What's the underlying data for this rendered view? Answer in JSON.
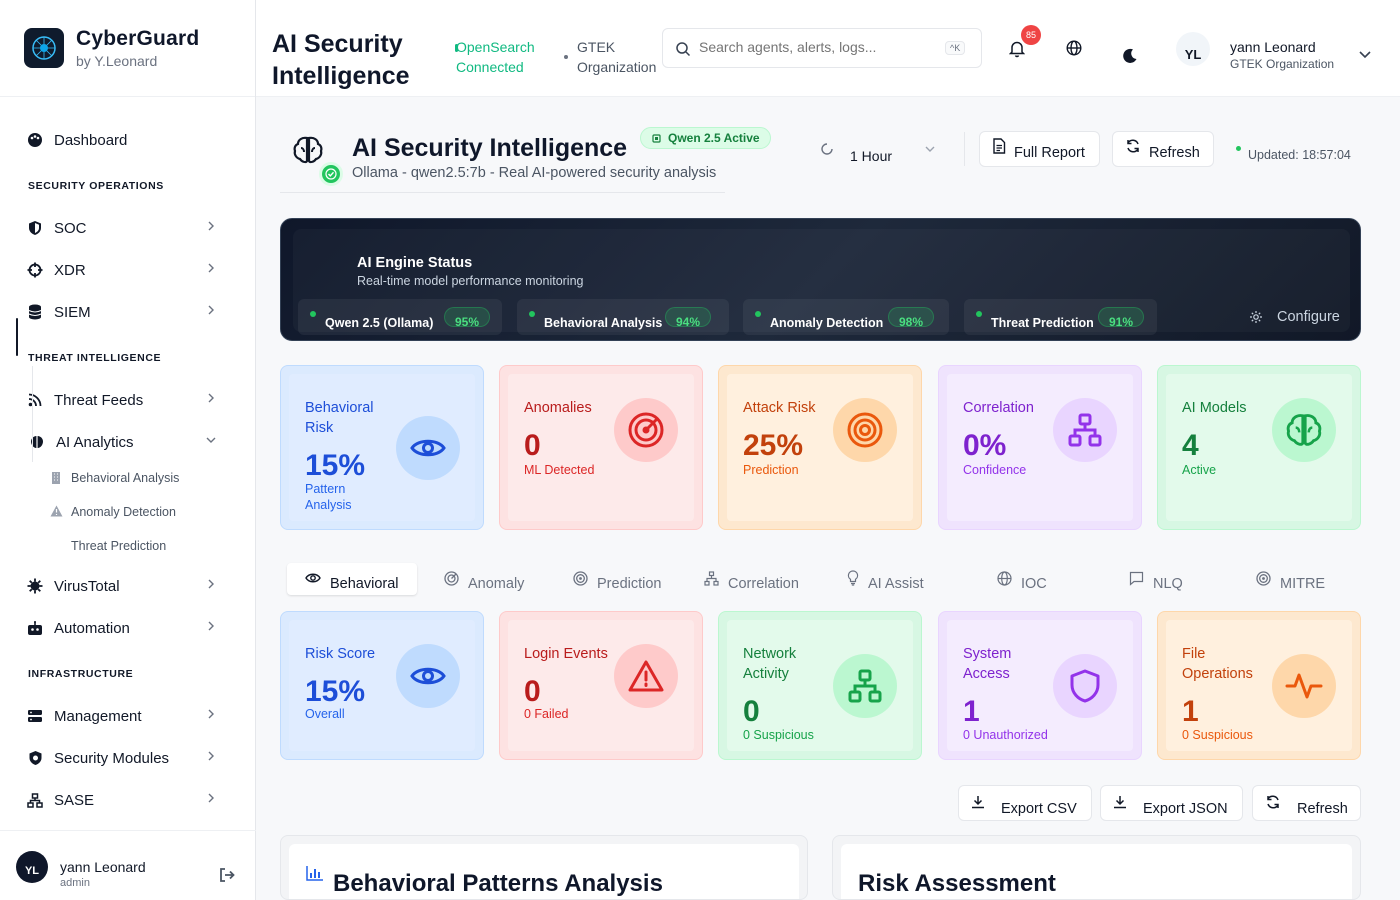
{
  "brand": {
    "title": "CyberGuard",
    "subtitle": "by Y.Leonard"
  },
  "sidebar": {
    "dashboard": "Dashboard",
    "section_security": "SECURITY OPERATIONS",
    "soc": "SOC",
    "xdr": "XDR",
    "siem": "SIEM",
    "section_threat": "THREAT INTELLIGENCE",
    "threat_feeds": "Threat Feeds",
    "ai_analytics": "AI Analytics",
    "sub_behavioral": "Behavioral Analysis",
    "sub_anomaly": "Anomaly Detection",
    "sub_prediction": "Threat Prediction",
    "virustotal": "VirusTotal",
    "automation": "Automation",
    "section_infra": "INFRASTRUCTURE",
    "management": "Management",
    "security_modules": "Security Modules",
    "sase": "SASE"
  },
  "footer_user": {
    "initials": "YL",
    "name": "yann Leonard",
    "role": "admin"
  },
  "header": {
    "title": "AI Security Intelligence",
    "connection_line1": "OpenSearch",
    "connection_line2": "Connected",
    "org_line1": "GTEK",
    "org_line2": "Organization",
    "search_placeholder": "Search agents, alerts, logs...",
    "search_shortcut": "^K",
    "notification_count": "85",
    "user_initials": "YL",
    "user_name": "yann Leonard",
    "user_org": "GTEK Organization"
  },
  "page": {
    "title": "AI Security Intelligence",
    "status_pill": "Qwen 2.5 Active",
    "subtitle": "Ollama - qwen2.5:7b - Real AI-powered security analysis",
    "time_range": "1 Hour",
    "full_report": "Full Report",
    "refresh": "Refresh",
    "updated": "Updated: 18:57:04"
  },
  "engine": {
    "title": "AI Engine Status",
    "subtitle": "Real-time model performance monitoring",
    "models": [
      {
        "name": "Qwen 2.5 (Ollama)",
        "pct": "95%"
      },
      {
        "name": "Behavioral Analysis",
        "pct": "94%"
      },
      {
        "name": "Anomaly Detection",
        "pct": "98%"
      },
      {
        "name": "Threat Prediction",
        "pct": "91%"
      }
    ],
    "configure": "Configure"
  },
  "stats": [
    {
      "label_line1": "Behavioral",
      "label_line2": "Risk",
      "value": "15%",
      "cap_line1": "Pattern",
      "cap_line2": "Analysis",
      "icon": "eye-icon",
      "color": "#1d4ed8"
    },
    {
      "label": "Anomalies",
      "value": "0",
      "cap": "ML Detected",
      "icon": "radar-icon",
      "color": "#b91c1c"
    },
    {
      "label": "Attack Risk",
      "value": "25%",
      "cap": "Prediction",
      "icon": "target-icon",
      "color": "#c2410c"
    },
    {
      "label": "Correlation",
      "value": "0%",
      "cap": "Confidence",
      "icon": "network-icon",
      "color": "#7e22ce"
    },
    {
      "label": "AI Models",
      "value": "4",
      "cap": "Active",
      "icon": "brain-icon",
      "color": "#15803d"
    }
  ],
  "tabs": [
    "Behavioral",
    "Anomaly",
    "Prediction",
    "Correlation",
    "AI Assist",
    "IOC",
    "NLQ",
    "MITRE"
  ],
  "behavior_cards": [
    {
      "label": "Risk Score",
      "value": "15%",
      "cap": "Overall",
      "icon": "eye-icon"
    },
    {
      "label": "Login Events",
      "value": "0",
      "cap": "0 Failed",
      "icon": "warning-icon"
    },
    {
      "label_line1": "Network",
      "label_line2": "Activity",
      "value": "0",
      "cap": "0 Suspicious",
      "icon": "network-icon"
    },
    {
      "label_line1": "System",
      "label_line2": "Access",
      "value": "1",
      "cap": "0 Unauthorized",
      "icon": "shield-icon"
    },
    {
      "label_line1": "File",
      "label_line2": "Operations",
      "value": "1",
      "cap": "0 Suspicious",
      "icon": "activity-icon"
    }
  ],
  "exports": {
    "csv": "Export CSV",
    "json": "Export JSON",
    "refresh": "Refresh"
  },
  "sections": {
    "behavioral": "Behavioral Patterns Analysis",
    "risk": "Risk Assessment"
  }
}
